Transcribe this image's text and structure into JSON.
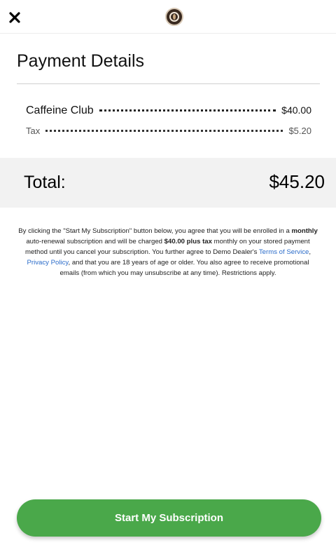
{
  "header": {
    "close_icon": "close-icon",
    "logo_icon": "coffee-logo-icon"
  },
  "page": {
    "title": "Payment Details"
  },
  "line_items": [
    {
      "label": "Caffeine Club",
      "amount": "$40.00"
    },
    {
      "label": "Tax",
      "amount": "$5.20"
    }
  ],
  "total": {
    "label": "Total:",
    "value": "$45.20"
  },
  "legal": {
    "p1": "By clicking the \"Start My Subscription\" button below, you agree that you will be enrolled in a ",
    "b1": "monthly",
    "p2": " auto-renewal subscription and will be charged ",
    "b2": "$40.00 plus tax",
    "p3": " monthly on your stored payment method until you cancel your subscription. You further agree to Demo Dealer's ",
    "terms_link": "Terms of Service",
    "p4": ", ",
    "privacy_link": "Privacy Policy",
    "p5": ", and that you are 18 years of age or older. You also agree to receive promotional emails (from which you may unsubscribe at any time). Restrictions apply."
  },
  "cta": {
    "label": "Start My Subscription"
  },
  "colors": {
    "cta_green": "#4aa84a",
    "link_blue": "#2a6bc9",
    "total_band": "#f2f2f2"
  }
}
